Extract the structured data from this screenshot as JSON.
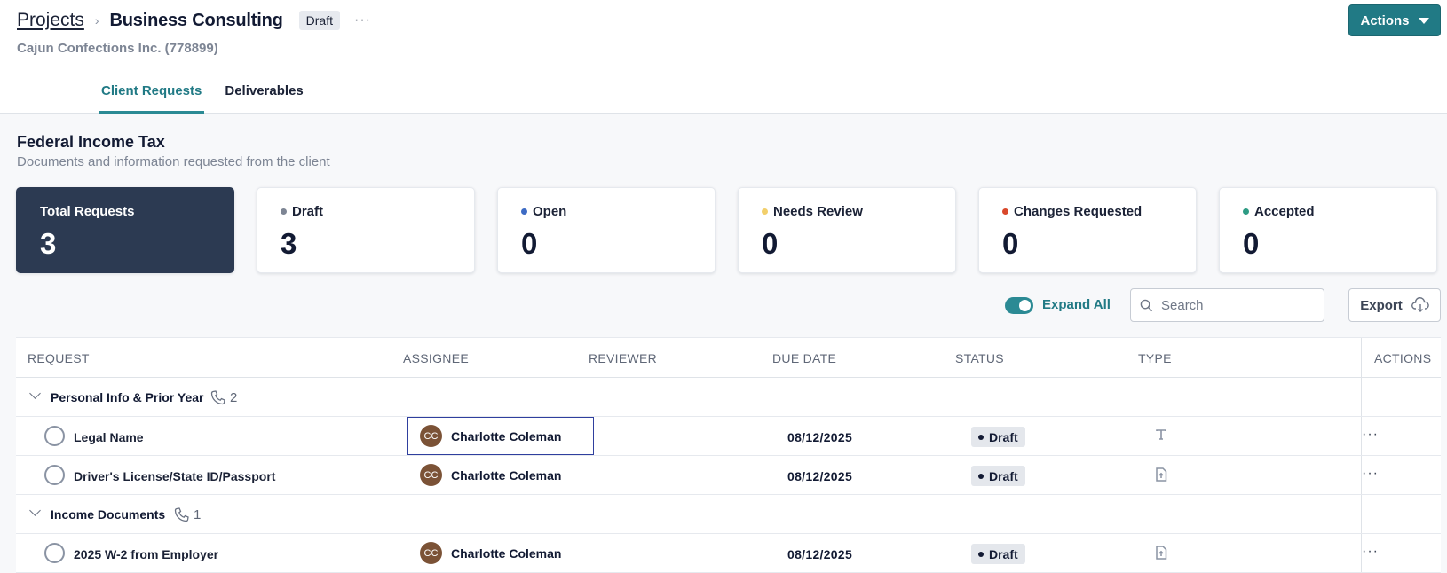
{
  "breadcrumb": {
    "parent": "Projects",
    "current": "Business Consulting",
    "status_badge": "Draft",
    "more": "···"
  },
  "client": "Cajun Confections Inc. (778899)",
  "header": {
    "actions_label": "Actions"
  },
  "tabs": [
    {
      "label": "Client Requests",
      "active": true
    },
    {
      "label": "Deliverables",
      "active": false
    }
  ],
  "section": {
    "title": "Federal Income Tax",
    "subtitle": "Documents and information requested from the client"
  },
  "summary_cards": [
    {
      "label": "Total Requests",
      "value": "3",
      "dot_color": ""
    },
    {
      "label": "Draft",
      "value": "3",
      "dot_color": "#7d8594"
    },
    {
      "label": "Open",
      "value": "0",
      "dot_color": "#3d6bc4"
    },
    {
      "label": "Needs Review",
      "value": "0",
      "dot_color": "#f2cf6b"
    },
    {
      "label": "Changes Requested",
      "value": "0",
      "dot_color": "#d9482b"
    },
    {
      "label": "Accepted",
      "value": "0",
      "dot_color": "#2e9b84"
    }
  ],
  "toolbar": {
    "expand_all_label": "Expand All",
    "expand_all_on": true,
    "search_placeholder": "Search",
    "export_label": "Export"
  },
  "table": {
    "headers": {
      "request": "REQUEST",
      "assignee": "ASSIGNEE",
      "reviewer": "REVIEWER",
      "due_date": "DUE DATE",
      "status": "STATUS",
      "type": "TYPE",
      "actions": "ACTIONS"
    },
    "groups": [
      {
        "name": "Personal Info & Prior Year",
        "count": "2",
        "items": [
          {
            "name": "Legal Name",
            "assignee_initials": "CC",
            "assignee": "Charlotte Coleman",
            "reviewer": "",
            "due": "08/12/2025",
            "status": "Draft",
            "type": "text-icon"
          },
          {
            "name": "Driver's License/State ID/Passport",
            "assignee_initials": "CC",
            "assignee": "Charlotte Coleman",
            "reviewer": "",
            "due": "08/12/2025",
            "status": "Draft",
            "type": "file-upload-icon"
          }
        ]
      },
      {
        "name": "Income Documents",
        "count": "1",
        "items": [
          {
            "name": "2025 W-2 from Employer",
            "assignee_initials": "CC",
            "assignee": "Charlotte Coleman",
            "reviewer": "",
            "due": "08/12/2025",
            "status": "Draft",
            "type": "file-upload-icon"
          }
        ]
      }
    ],
    "row_menu": "···"
  },
  "colors": {
    "accent": "#217a85",
    "navy_card": "#2c3a52",
    "avatar": "#7b5236"
  }
}
